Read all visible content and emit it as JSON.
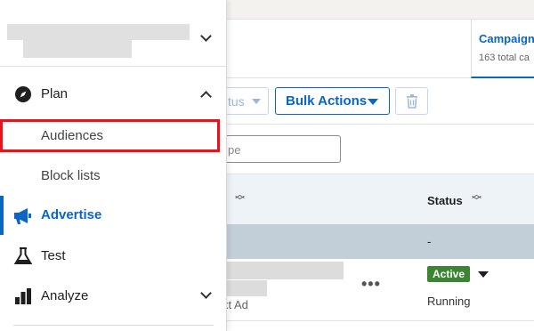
{
  "page": {
    "tab": {
      "title": "Campaigns",
      "subtitle": "163 total ca"
    },
    "toolbar": {
      "status_label": "tus",
      "bulk_actions_label": "Bulk Actions"
    },
    "filter": {
      "search_placeholder": "pe"
    },
    "table": {
      "status_header": "Status",
      "totals_status": "-",
      "row": {
        "ad_type": "xt Ad",
        "more_label": "•••",
        "status_badge": "Active",
        "delivery": "Running"
      }
    }
  },
  "sidebar": {
    "items": [
      {
        "label": "Plan",
        "icon": "compass-icon"
      },
      {
        "label": "Audiences"
      },
      {
        "label": "Block lists"
      },
      {
        "label": "Advertise",
        "icon": "megaphone-icon",
        "active": true
      },
      {
        "label": "Test",
        "icon": "flask-icon"
      },
      {
        "label": "Analyze",
        "icon": "bar-chart-icon"
      }
    ]
  },
  "colors": {
    "accent": "#0a66c2",
    "highlight": "#e8141b",
    "active_badge": "#3e8435"
  }
}
